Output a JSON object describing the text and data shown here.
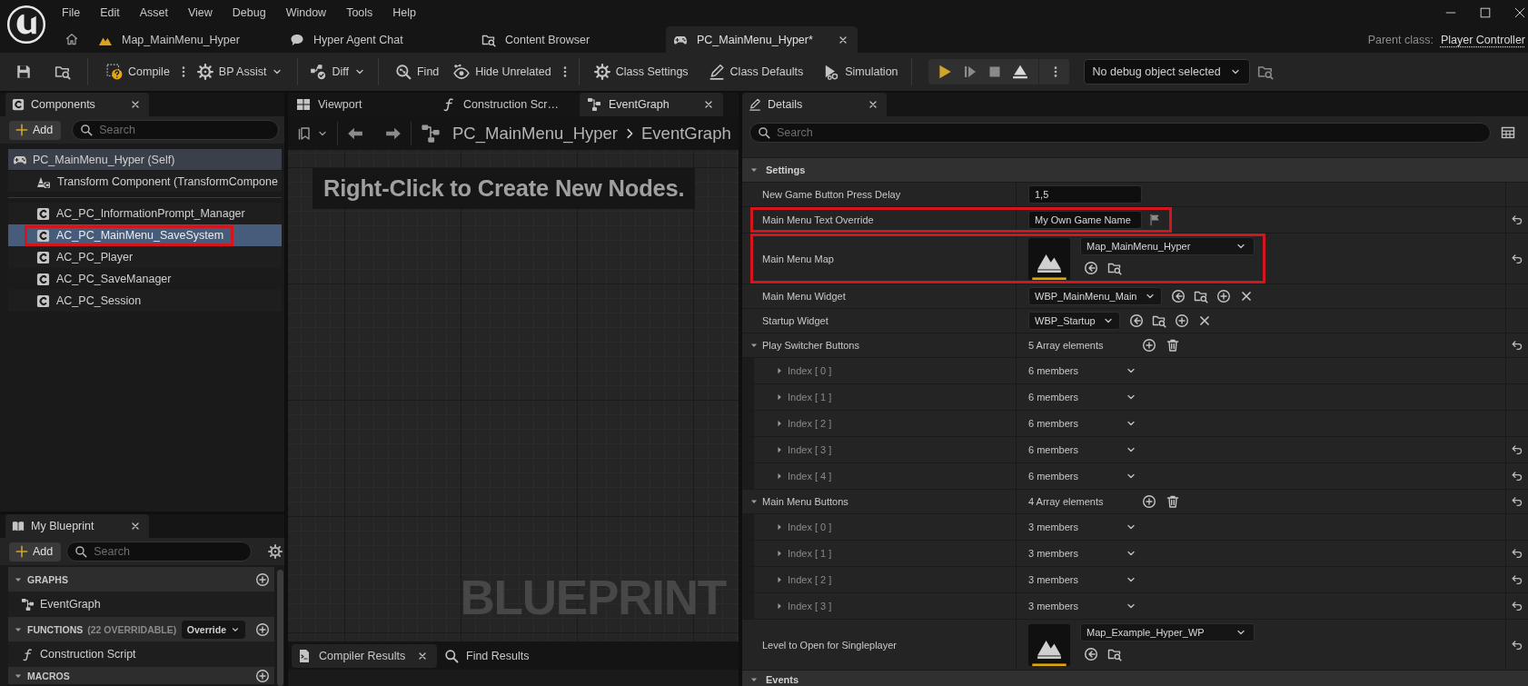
{
  "menu_bar": {
    "items": [
      "File",
      "Edit",
      "Asset",
      "View",
      "Debug",
      "Window",
      "Tools",
      "Help"
    ]
  },
  "document_tabs": [
    {
      "label": "Map_MainMenu_Hyper",
      "kind": "level",
      "selected": false
    },
    {
      "label": "Hyper Agent Chat",
      "kind": "chat",
      "selected": false
    },
    {
      "label": "Content Browser",
      "kind": "browser",
      "selected": false
    },
    {
      "label": "PC_MainMenu_Hyper*",
      "kind": "blueprint",
      "selected": true
    }
  ],
  "parent_class": {
    "label": "Parent class:",
    "value": "Player Controller"
  },
  "toolbar": {
    "compile": "Compile",
    "bp_assist": "BP Assist",
    "diff": "Diff",
    "find": "Find",
    "hide_unrelated": "Hide Unrelated",
    "class_settings": "Class Settings",
    "class_defaults": "Class Defaults",
    "simulation": "Simulation",
    "debug_object": "No debug object selected"
  },
  "components_panel": {
    "title": "Components",
    "add_button": "Add",
    "search": {
      "placeholder": "Search"
    },
    "tree": [
      {
        "label": "PC_MainMenu_Hyper (Self)",
        "children": [
          {
            "label": "Transform Component (TransformCompone"
          }
        ]
      }
    ],
    "items": [
      {
        "label": "AC_PC_InformationPrompt_Manager",
        "selected": false,
        "highlighted": false
      },
      {
        "label": "AC_PC_MainMenu_SaveSystem",
        "selected": true,
        "highlighted": true
      },
      {
        "label": "AC_PC_Player",
        "selected": false,
        "highlighted": false
      },
      {
        "label": "AC_PC_SaveManager",
        "selected": false,
        "highlighted": false
      },
      {
        "label": "AC_PC_Session",
        "selected": false,
        "highlighted": false
      }
    ]
  },
  "my_blueprint": {
    "title": "My Blueprint",
    "add_button": "Add",
    "search": {
      "placeholder": "Search"
    },
    "sections": [
      {
        "title": "GRAPHS",
        "expanded": true,
        "items": [
          {
            "label": "EventGraph",
            "kind": "graph"
          }
        ]
      },
      {
        "title": "FUNCTIONS",
        "note": "(22 OVERRIDABLE)",
        "dropdown": "Override",
        "expanded": true,
        "items": [
          {
            "label": "Construction Script",
            "kind": "function"
          }
        ]
      },
      {
        "title": "MACROS",
        "expanded": true
      }
    ]
  },
  "graph_editor": {
    "tabs": [
      {
        "label": "Viewport",
        "kind": "viewport",
        "selected": false
      },
      {
        "label": "Construction Scr…",
        "kind": "function",
        "selected": false
      },
      {
        "label": "EventGraph",
        "kind": "graph",
        "selected": true
      }
    ],
    "breadcrumb": [
      "PC_MainMenu_Hyper",
      "EventGraph"
    ],
    "hint": "Right-Click to Create New Nodes.",
    "watermark": "BLUEPRINT",
    "bottom_tabs": [
      {
        "label": "Compiler Results",
        "kind": "results",
        "selected": true
      },
      {
        "label": "Find Results",
        "kind": "find",
        "selected": false
      }
    ]
  },
  "details": {
    "title": "Details",
    "search": {
      "placeholder": "Search"
    },
    "categories": [
      {
        "title": "Settings",
        "expanded": true,
        "properties": [
          {
            "kind": "number",
            "name": "New Game Button Press Delay",
            "value": "1,5",
            "resettable": false,
            "highlighted": false
          },
          {
            "kind": "text",
            "name": "Main Menu Text Override",
            "value": "My Own Game Name",
            "resettable": true,
            "highlighted": true
          },
          {
            "kind": "asset",
            "name": "Main Menu Map",
            "value": "Map_MainMenu_Hyper",
            "resettable": true,
            "highlighted": true
          },
          {
            "kind": "class",
            "name": "Main Menu Widget",
            "value": "WBP_MainMenu_Main",
            "resettable": false,
            "highlighted": false
          },
          {
            "kind": "class",
            "name": "Startup Widget",
            "value": "WBP_Startup",
            "resettable": false,
            "highlighted": false
          },
          {
            "kind": "array",
            "name": "Play Switcher Buttons",
            "value": "5 Array elements",
            "expanded": true,
            "resettable": true,
            "highlighted": false,
            "elements": [
              {
                "name": "Index [ 0 ]",
                "value": "6 members",
                "expanded": false,
                "resettable": false
              },
              {
                "name": "Index [ 1 ]",
                "value": "6 members",
                "expanded": false,
                "resettable": false
              },
              {
                "name": "Index [ 2 ]",
                "value": "6 members",
                "expanded": false,
                "resettable": false
              },
              {
                "name": "Index [ 3 ]",
                "value": "6 members",
                "expanded": false,
                "resettable": true
              },
              {
                "name": "Index [ 4 ]",
                "value": "6 members",
                "expanded": false,
                "resettable": true
              }
            ]
          },
          {
            "kind": "array",
            "name": "Main Menu Buttons",
            "value": "4 Array elements",
            "expanded": true,
            "resettable": true,
            "highlighted": false,
            "elements": [
              {
                "name": "Index [ 0 ]",
                "value": "3 members",
                "expanded": false,
                "resettable": false
              },
              {
                "name": "Index [ 1 ]",
                "value": "3 members",
                "expanded": false,
                "resettable": true
              },
              {
                "name": "Index [ 2 ]",
                "value": "3 members",
                "expanded": false,
                "resettable": true
              },
              {
                "name": "Index [ 3 ]",
                "value": "3 members",
                "expanded": false,
                "resettable": true
              }
            ]
          },
          {
            "kind": "asset",
            "name": "Level to Open for Singleplayer",
            "value": "Map_Example_Hyper_WP",
            "resettable": true,
            "highlighted": false
          }
        ]
      },
      {
        "title": "Events",
        "expanded": true
      }
    ]
  }
}
